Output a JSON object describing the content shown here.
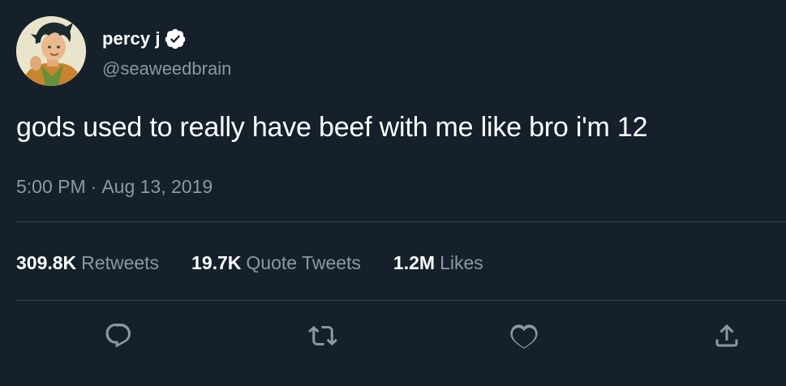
{
  "user": {
    "display_name": "percy j",
    "handle": "@seaweedbrain",
    "verified": true
  },
  "tweet": {
    "text": "gods used to really have beef with me like bro i'm 12",
    "time": "5:00 PM",
    "separator": "·",
    "date": "Aug 13, 2019"
  },
  "stats": [
    {
      "value": "309.8K",
      "label": "Retweets"
    },
    {
      "value": "19.7K",
      "label": "Quote Tweets"
    },
    {
      "value": "1.2M",
      "label": "Likes"
    }
  ],
  "actions": [
    "reply-icon",
    "retweet-icon",
    "like-icon",
    "share-icon"
  ],
  "colors": {
    "background": "#15202b",
    "text": "#ffffff",
    "secondary": "#8b98a5",
    "divider": "#38444d",
    "verified_badge": "#ffffff"
  }
}
